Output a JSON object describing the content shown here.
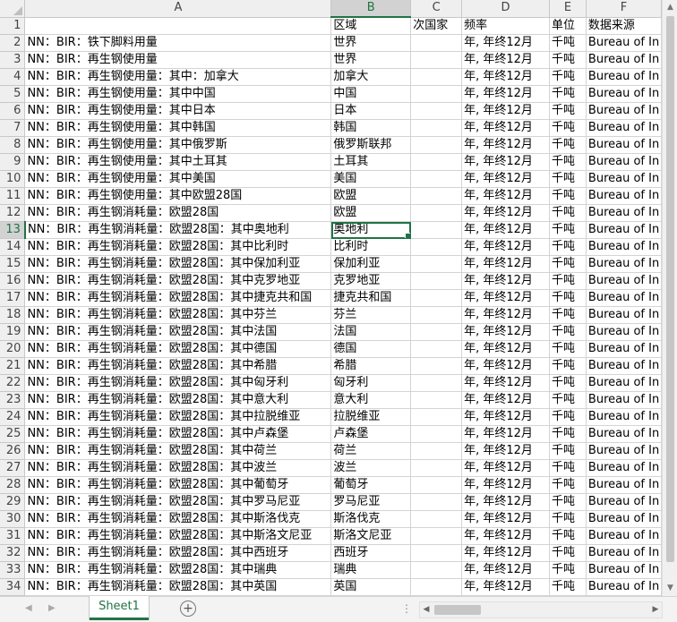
{
  "columns": [
    "A",
    "B",
    "C",
    "D",
    "E",
    "F"
  ],
  "selected_column": "B",
  "selected_row": 13,
  "rows": [
    {
      "n": "1",
      "a": "",
      "b": "区域",
      "c": "次国家",
      "d": "频率",
      "e": "单位",
      "f": "数据来源"
    },
    {
      "n": "2",
      "a": "NN：BIR：铁下脚料用量",
      "b": "世界",
      "c": "",
      "d": "年, 年终12月",
      "e": "千吨",
      "f": "Bureau of In"
    },
    {
      "n": "3",
      "a": "NN：BIR：再生钢使用量",
      "b": "世界",
      "c": "",
      "d": "年, 年终12月",
      "e": "千吨",
      "f": "Bureau of In"
    },
    {
      "n": "4",
      "a": "NN：BIR：再生钢使用量：其中：加拿大",
      "b": "加拿大",
      "c": "",
      "d": "年, 年终12月",
      "e": "千吨",
      "f": "Bureau of In"
    },
    {
      "n": "5",
      "a": "NN：BIR：再生钢使用量：其中中国",
      "b": "中国",
      "c": "",
      "d": "年, 年终12月",
      "e": "千吨",
      "f": "Bureau of In"
    },
    {
      "n": "6",
      "a": "NN：BIR：再生钢使用量：其中日本",
      "b": "日本",
      "c": "",
      "d": "年, 年终12月",
      "e": "千吨",
      "f": "Bureau of In"
    },
    {
      "n": "7",
      "a": "NN：BIR：再生钢使用量：其中韩国",
      "b": "韩国",
      "c": "",
      "d": "年, 年终12月",
      "e": "千吨",
      "f": "Bureau of In"
    },
    {
      "n": "8",
      "a": "NN：BIR：再生钢使用量：其中俄罗斯",
      "b": "俄罗斯联邦",
      "c": "",
      "d": "年, 年终12月",
      "e": "千吨",
      "f": "Bureau of In"
    },
    {
      "n": "9",
      "a": "NN：BIR：再生钢使用量：其中土耳其",
      "b": "土耳其",
      "c": "",
      "d": "年, 年终12月",
      "e": "千吨",
      "f": "Bureau of In"
    },
    {
      "n": "10",
      "a": "NN：BIR：再生钢使用量：其中美国",
      "b": "美国",
      "c": "",
      "d": "年, 年终12月",
      "e": "千吨",
      "f": "Bureau of In"
    },
    {
      "n": "11",
      "a": "NN：BIR：再生钢使用量：其中欧盟28国",
      "b": "欧盟",
      "c": "",
      "d": "年, 年终12月",
      "e": "千吨",
      "f": "Bureau of In"
    },
    {
      "n": "12",
      "a": "NN：BIR：再生钢消耗量：欧盟28国",
      "b": "欧盟",
      "c": "",
      "d": "年, 年终12月",
      "e": "千吨",
      "f": "Bureau of In"
    },
    {
      "n": "13",
      "a": "NN：BIR：再生钢消耗量：欧盟28国：其中奥地利",
      "b": "奥地利",
      "c": "",
      "d": "年, 年终12月",
      "e": "千吨",
      "f": "Bureau of In"
    },
    {
      "n": "14",
      "a": "NN：BIR：再生钢消耗量：欧盟28国：其中比利时",
      "b": "比利时",
      "c": "",
      "d": "年, 年终12月",
      "e": "千吨",
      "f": "Bureau of In"
    },
    {
      "n": "15",
      "a": "NN：BIR：再生钢消耗量：欧盟28国：其中保加利亚",
      "b": "保加利亚",
      "c": "",
      "d": "年, 年终12月",
      "e": "千吨",
      "f": "Bureau of In"
    },
    {
      "n": "16",
      "a": "NN：BIR：再生钢消耗量：欧盟28国：其中克罗地亚",
      "b": "克罗地亚",
      "c": "",
      "d": "年, 年终12月",
      "e": "千吨",
      "f": "Bureau of In"
    },
    {
      "n": "17",
      "a": "NN：BIR：再生钢消耗量：欧盟28国：其中捷克共和国",
      "b": "捷克共和国",
      "c": "",
      "d": "年, 年终12月",
      "e": "千吨",
      "f": "Bureau of In"
    },
    {
      "n": "18",
      "a": "NN：BIR：再生钢消耗量：欧盟28国：其中芬兰",
      "b": "芬兰",
      "c": "",
      "d": "年, 年终12月",
      "e": "千吨",
      "f": "Bureau of In"
    },
    {
      "n": "19",
      "a": "NN：BIR：再生钢消耗量：欧盟28国：其中法国",
      "b": "法国",
      "c": "",
      "d": "年, 年终12月",
      "e": "千吨",
      "f": "Bureau of In"
    },
    {
      "n": "20",
      "a": "NN：BIR：再生钢消耗量：欧盟28国：其中德国",
      "b": "德国",
      "c": "",
      "d": "年, 年终12月",
      "e": "千吨",
      "f": "Bureau of In"
    },
    {
      "n": "21",
      "a": "NN：BIR：再生钢消耗量：欧盟28国：其中希腊",
      "b": "希腊",
      "c": "",
      "d": "年, 年终12月",
      "e": "千吨",
      "f": "Bureau of In"
    },
    {
      "n": "22",
      "a": "NN：BIR：再生钢消耗量：欧盟28国：其中匈牙利",
      "b": "匈牙利",
      "c": "",
      "d": "年, 年终12月",
      "e": "千吨",
      "f": "Bureau of In"
    },
    {
      "n": "23",
      "a": "NN：BIR：再生钢消耗量：欧盟28国：其中意大利",
      "b": "意大利",
      "c": "",
      "d": "年, 年终12月",
      "e": "千吨",
      "f": "Bureau of In"
    },
    {
      "n": "24",
      "a": "NN：BIR：再生钢消耗量：欧盟28国：其中拉脱维亚",
      "b": "拉脱维亚",
      "c": "",
      "d": "年, 年终12月",
      "e": "千吨",
      "f": "Bureau of In"
    },
    {
      "n": "25",
      "a": "NN：BIR：再生钢消耗量：欧盟28国：其中卢森堡",
      "b": "卢森堡",
      "c": "",
      "d": "年, 年终12月",
      "e": "千吨",
      "f": "Bureau of In"
    },
    {
      "n": "26",
      "a": "NN：BIR：再生钢消耗量：欧盟28国：其中荷兰",
      "b": "荷兰",
      "c": "",
      "d": "年, 年终12月",
      "e": "千吨",
      "f": "Bureau of In"
    },
    {
      "n": "27",
      "a": "NN：BIR：再生钢消耗量：欧盟28国：其中波兰",
      "b": "波兰",
      "c": "",
      "d": "年, 年终12月",
      "e": "千吨",
      "f": "Bureau of In"
    },
    {
      "n": "28",
      "a": "NN：BIR：再生钢消耗量：欧盟28国：其中葡萄牙",
      "b": "葡萄牙",
      "c": "",
      "d": "年, 年终12月",
      "e": "千吨",
      "f": "Bureau of In"
    },
    {
      "n": "29",
      "a": "NN：BIR：再生钢消耗量：欧盟28国：其中罗马尼亚",
      "b": "罗马尼亚",
      "c": "",
      "d": "年, 年终12月",
      "e": "千吨",
      "f": "Bureau of In"
    },
    {
      "n": "30",
      "a": "NN：BIR：再生钢消耗量：欧盟28国：其中斯洛伐克",
      "b": "斯洛伐克",
      "c": "",
      "d": "年, 年终12月",
      "e": "千吨",
      "f": "Bureau of In"
    },
    {
      "n": "31",
      "a": "NN：BIR：再生钢消耗量：欧盟28国：其中斯洛文尼亚",
      "b": "斯洛文尼亚",
      "c": "",
      "d": "年, 年终12月",
      "e": "千吨",
      "f": "Bureau of In"
    },
    {
      "n": "32",
      "a": "NN：BIR：再生钢消耗量：欧盟28国：其中西班牙",
      "b": "西班牙",
      "c": "",
      "d": "年, 年终12月",
      "e": "千吨",
      "f": "Bureau of In"
    },
    {
      "n": "33",
      "a": "NN：BIR：再生钢消耗量：欧盟28国：其中瑞典",
      "b": "瑞典",
      "c": "",
      "d": "年, 年终12月",
      "e": "千吨",
      "f": "Bureau of In"
    },
    {
      "n": "34",
      "a": "NN：BIR：再生钢消耗量：欧盟28国：其中英国",
      "b": "英国",
      "c": "",
      "d": "年, 年终12月",
      "e": "千吨",
      "f": "Bureau of In"
    }
  ],
  "sheet_tab": "Sheet1",
  "add_sheet_label": "+",
  "colors": {
    "accent": "#217346",
    "header_bg": "#efefef",
    "grid": "#d4d4d4"
  }
}
